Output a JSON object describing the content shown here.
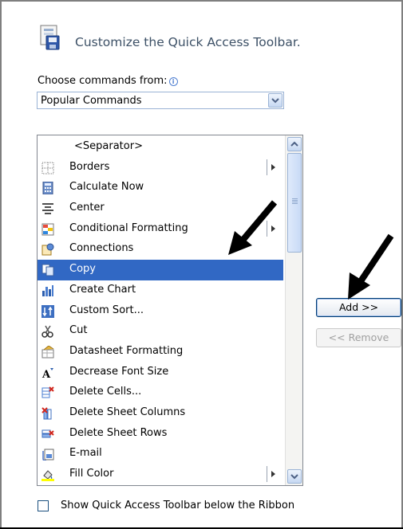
{
  "header": {
    "title": "Customize the Quick Access Toolbar.",
    "icon": "quick-access-toolbar-icon"
  },
  "choose": {
    "label": "Choose commands from:",
    "value": "Popular Commands"
  },
  "commands": {
    "items": [
      {
        "label": "<Separator>",
        "icon": "none",
        "submenu": false,
        "selected": false
      },
      {
        "label": "Borders",
        "icon": "borders-icon",
        "submenu": true,
        "selected": false
      },
      {
        "label": "Calculate Now",
        "icon": "calculator-icon",
        "submenu": false,
        "selected": false
      },
      {
        "label": "Center",
        "icon": "align-center-icon",
        "submenu": false,
        "selected": false
      },
      {
        "label": "Conditional Formatting",
        "icon": "conditional-formatting-icon",
        "submenu": true,
        "selected": false
      },
      {
        "label": "Connections",
        "icon": "connections-icon",
        "submenu": false,
        "selected": false
      },
      {
        "label": "Copy",
        "icon": "copy-icon",
        "submenu": false,
        "selected": true
      },
      {
        "label": "Create Chart",
        "icon": "chart-icon",
        "submenu": false,
        "selected": false
      },
      {
        "label": "Custom Sort...",
        "icon": "sort-icon",
        "submenu": false,
        "selected": false
      },
      {
        "label": "Cut",
        "icon": "scissors-icon",
        "submenu": false,
        "selected": false
      },
      {
        "label": "Datasheet Formatting",
        "icon": "datasheet-icon",
        "submenu": false,
        "selected": false
      },
      {
        "label": "Decrease Font Size",
        "icon": "decrease-font-icon",
        "submenu": false,
        "selected": false
      },
      {
        "label": "Delete Cells...",
        "icon": "delete-cells-icon",
        "submenu": false,
        "selected": false
      },
      {
        "label": "Delete Sheet Columns",
        "icon": "delete-columns-icon",
        "submenu": false,
        "selected": false
      },
      {
        "label": "Delete Sheet Rows",
        "icon": "delete-rows-icon",
        "submenu": false,
        "selected": false
      },
      {
        "label": "E-mail",
        "icon": "email-icon",
        "submenu": false,
        "selected": false
      },
      {
        "label": "Fill Color",
        "icon": "fill-color-icon",
        "submenu": true,
        "selected": false
      }
    ]
  },
  "buttons": {
    "add": "Add >>",
    "remove": "<< Remove"
  },
  "checkbox": {
    "label": "Show Quick Access Toolbar below the Ribbon",
    "checked": false
  },
  "colors": {
    "selection": "#3168c4",
    "title_text": "#3c5066",
    "annotation_arrow": "#000000"
  }
}
